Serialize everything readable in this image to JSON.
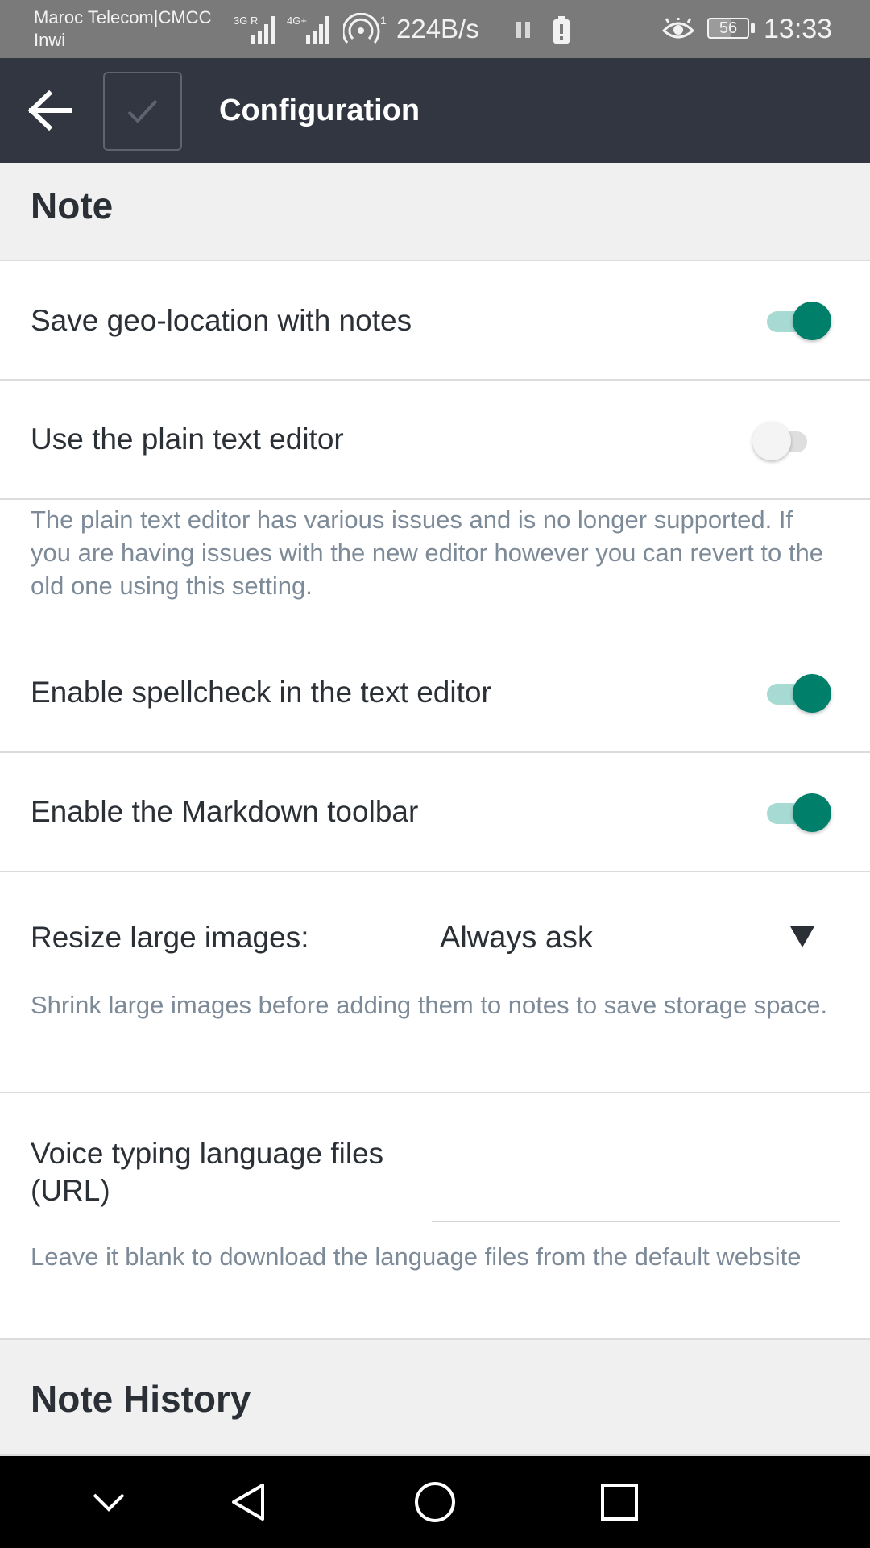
{
  "status_bar": {
    "carrier_line1": "Maroc Telecom|CMCC",
    "carrier_line2": "Inwi",
    "network_1": "3G R",
    "network_2": "4G+",
    "hotspot_count": "1",
    "speed": "224B/s",
    "battery": "56",
    "time": "13:33"
  },
  "app_bar": {
    "title": "Configuration",
    "back_icon": "arrow-left-icon",
    "check_icon": "checkmark-icon"
  },
  "sections": {
    "note": {
      "title": "Note"
    },
    "history": {
      "title": "Note History"
    }
  },
  "settings": {
    "geo_location": {
      "label": "Save geo-location with notes",
      "enabled": true
    },
    "plain_text_editor": {
      "label": "Use the plain text editor",
      "enabled": false,
      "description": "The plain text editor has various issues and is no longer supported. If you are having issues with the new editor however you can revert to the old one using this setting."
    },
    "spellcheck": {
      "label": "Enable spellcheck in the text editor",
      "enabled": true
    },
    "markdown_toolbar": {
      "label": "Enable the Markdown toolbar",
      "enabled": true
    },
    "resize_images": {
      "label": "Resize large images:",
      "value": "Always ask",
      "description": "Shrink large images before adding them to notes to save storage space."
    },
    "voice_typing": {
      "label_line1": "Voice typing language files",
      "label_line2": "(URL)",
      "value": "",
      "description": "Leave it blank to download the language files from the default website"
    }
  },
  "colors": {
    "app_bar": "#313640",
    "accent": "#00806a",
    "accent_track": "#a6dad2",
    "description_text": "#7d8a98"
  },
  "nav_bar": {
    "icons": [
      "chevron-down-icon",
      "back-triangle-icon",
      "home-circle-icon",
      "recents-square-icon"
    ]
  }
}
